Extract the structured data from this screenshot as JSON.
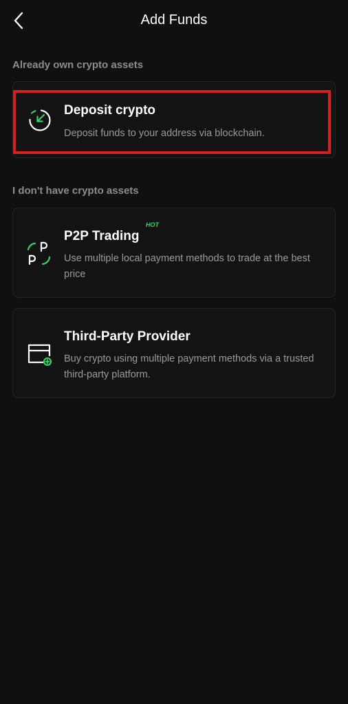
{
  "header": {
    "title": "Add Funds"
  },
  "sections": [
    {
      "label": "Already own crypto assets"
    },
    {
      "label": "I don't have crypto assets"
    }
  ],
  "options": [
    {
      "title": "Deposit crypto",
      "description": "Deposit funds to your address via blockchain.",
      "icon": "deposit-arrow-circle-icon"
    },
    {
      "title": "P2P Trading",
      "badge": "HOT",
      "description": "Use multiple local payment methods to trade at the best price",
      "icon": "p2p-icon"
    },
    {
      "title": "Third-Party Provider",
      "description": "Buy crypto using multiple payment methods via a trusted third-party platform.",
      "icon": "card-plus-icon"
    }
  ],
  "colors": {
    "background": "#101010",
    "card": "#131313",
    "accent": "#2fd664",
    "highlight": "#d61f1f"
  }
}
